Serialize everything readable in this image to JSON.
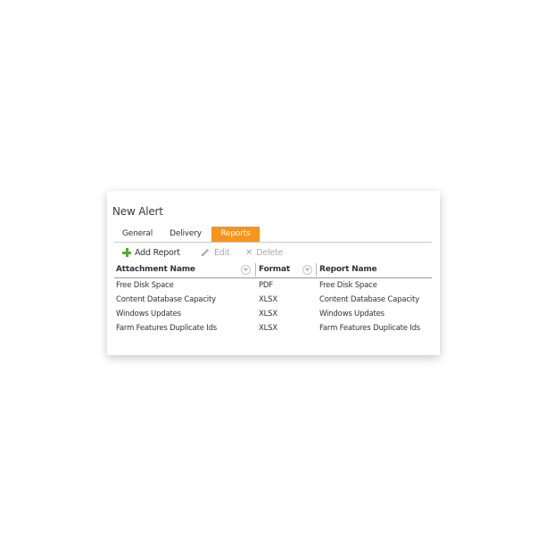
{
  "dialog": {
    "title": "New Alert",
    "tabs": [
      {
        "label": "General",
        "active": false
      },
      {
        "label": "Delivery",
        "active": false
      },
      {
        "label": "Reports",
        "active": true
      }
    ],
    "active_tab_color": "#f7941d"
  },
  "toolbar": {
    "add_label": "Add Report",
    "add_icon": "plus-icon",
    "edit_label": "Edit",
    "edit_icon": "pencil-icon",
    "delete_label": "Delete",
    "delete_icon": "x-icon"
  },
  "grid": {
    "columns": [
      "Attachment Name",
      "Format",
      "Report Name"
    ],
    "rows": [
      {
        "attachment": "Free Disk Space",
        "format": "PDF",
        "report": "Free Disk Space"
      },
      {
        "attachment": "Content Database Capacity",
        "format": "XLSX",
        "report": "Content Database Capacity"
      },
      {
        "attachment": "Windows Updates",
        "format": "XLSX",
        "report": "Windows Updates"
      },
      {
        "attachment": "Farm Features Duplicate Ids",
        "format": "XLSX",
        "report": "Farm Features Duplicate Ids"
      }
    ]
  }
}
